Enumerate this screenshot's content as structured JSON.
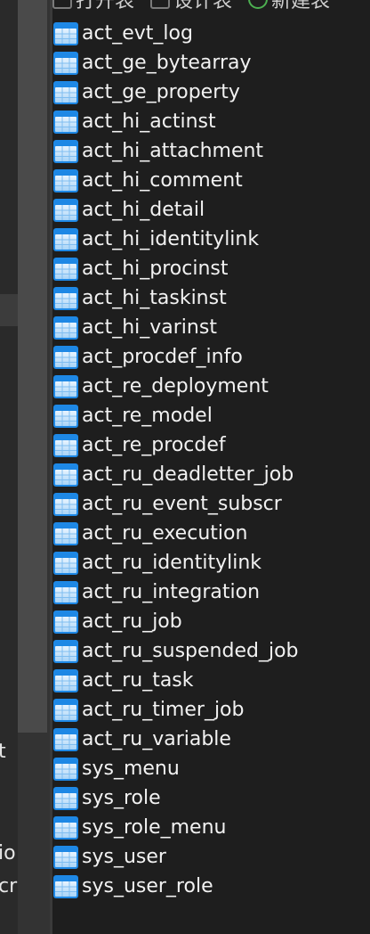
{
  "toolbar": {
    "items": [
      {
        "label": "打开表",
        "icon": "open-table-icon"
      },
      {
        "label": "设计表",
        "icon": "design-table-icon"
      },
      {
        "label": "新建表",
        "icon": "new-table-icon"
      }
    ]
  },
  "left_panel": {
    "fragments": [
      "t",
      "io",
      "cr"
    ]
  },
  "tables": [
    "act_evt_log",
    "act_ge_bytearray",
    "act_ge_property",
    "act_hi_actinst",
    "act_hi_attachment",
    "act_hi_comment",
    "act_hi_detail",
    "act_hi_identitylink",
    "act_hi_procinst",
    "act_hi_taskinst",
    "act_hi_varinst",
    "act_procdef_info",
    "act_re_deployment",
    "act_re_model",
    "act_re_procdef",
    "act_ru_deadletter_job",
    "act_ru_event_subscr",
    "act_ru_execution",
    "act_ru_identitylink",
    "act_ru_integration",
    "act_ru_job",
    "act_ru_suspended_job",
    "act_ru_task",
    "act_ru_timer_job",
    "act_ru_variable",
    "sys_menu",
    "sys_role",
    "sys_role_menu",
    "sys_user",
    "sys_user_role"
  ],
  "colors": {
    "background": "#1e1e1e",
    "text": "#f2f2f2",
    "table_icon_blue": "#1e88e5"
  }
}
